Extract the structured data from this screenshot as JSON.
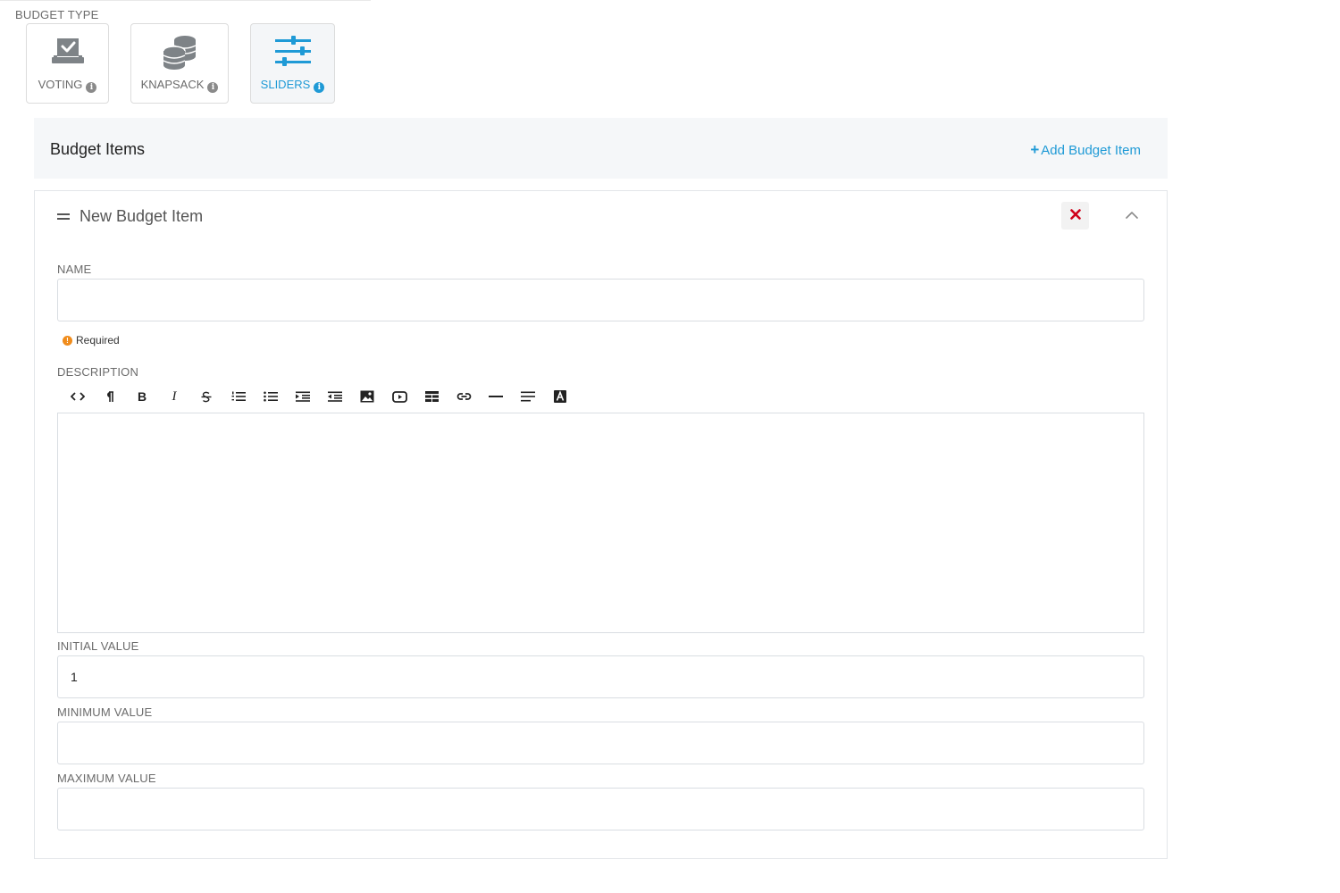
{
  "budget_type": {
    "label": "BUDGET TYPE",
    "options": [
      {
        "label": "VOTING",
        "icon": "ballot-check-icon",
        "selected": false
      },
      {
        "label": "KNAPSACK",
        "icon": "coins-stack-icon",
        "selected": false
      },
      {
        "label": "SLIDERS",
        "icon": "sliders-icon",
        "selected": true
      }
    ]
  },
  "budget_items": {
    "title": "Budget Items",
    "add_label": "Add Budget Item"
  },
  "item": {
    "title": "New Budget Item",
    "name_label": "NAME",
    "name_value": "",
    "required_text": "Required",
    "description_label": "DESCRIPTION",
    "toolbar": [
      "code-view-icon",
      "paragraph-icon",
      "bold-icon",
      "italic-icon",
      "strikethrough-icon",
      "ordered-list-icon",
      "unordered-list-icon",
      "indent-icon",
      "outdent-icon",
      "insert-image-icon",
      "insert-video-icon",
      "insert-table-icon",
      "insert-link-icon",
      "horizontal-rule-icon",
      "align-icon",
      "text-color-icon"
    ],
    "initial_label": "INITIAL VALUE",
    "initial_value": "1",
    "minimum_label": "MINIMUM VALUE",
    "minimum_value": "",
    "maximum_label": "MAXIMUM VALUE",
    "maximum_value": ""
  },
  "colors": {
    "accent": "#1f9ad6",
    "delete": "#d0021b",
    "required": "#f08c1c",
    "header_bg": "#f5f7f9"
  }
}
